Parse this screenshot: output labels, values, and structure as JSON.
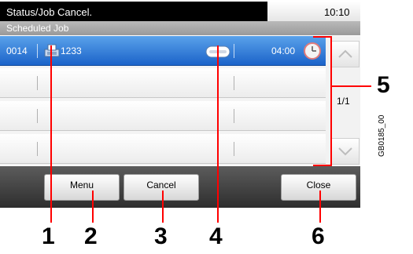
{
  "header": {
    "title": "Status/Job Cancel.",
    "time": "10:10"
  },
  "subheader": {
    "title": "Scheduled Job"
  },
  "jobs": [
    {
      "number": "0014",
      "icon": "fax-icon",
      "name": "1233",
      "status_icon": "ellipsis-icon",
      "time": "04:00",
      "time_icon": "clock-icon"
    }
  ],
  "scroll": {
    "page": "1/1",
    "up_icon": "chevron-up-icon",
    "down_icon": "chevron-down-icon"
  },
  "buttons": {
    "menu": "Menu",
    "cancel": "Cancel",
    "close": "Close"
  },
  "callouts": [
    "1",
    "2",
    "3",
    "4",
    "5",
    "6"
  ],
  "figure_code": "GB0185_00",
  "colors": {
    "selected_row": "#1b63c9",
    "callout_line": "#ff0000"
  }
}
